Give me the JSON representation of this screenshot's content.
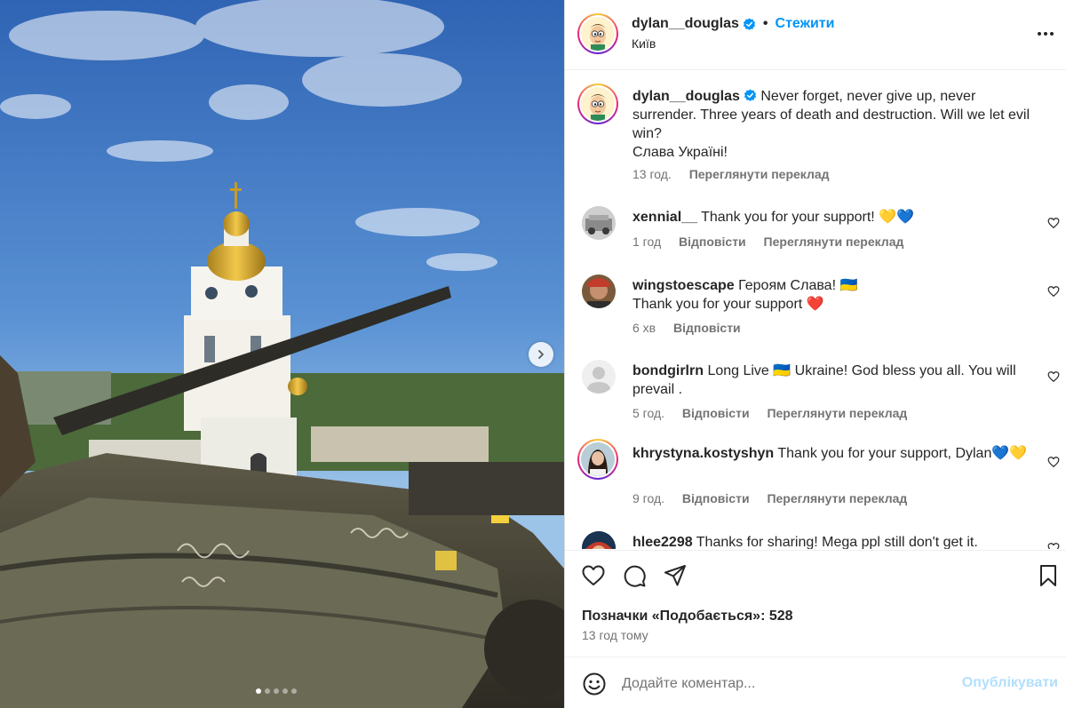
{
  "header": {
    "username": "dylan__douglas",
    "separator": "•",
    "follow_label": "Стежити",
    "location": "Київ",
    "more_icon": "more-horizontal-icon"
  },
  "media": {
    "next_icon": "chevron-right-icon",
    "slide_count": 5,
    "active_slide": 1
  },
  "caption": {
    "username": "dylan__douglas",
    "text_line1": "Never forget, never give up, never surrender. Three years of death and destruction. Will we let evil win?",
    "text_line2": "Слава Україні!",
    "time": "13 год.",
    "translate": "Переглянути переклад"
  },
  "comments": [
    {
      "username": "xennial__",
      "text": "Thank you for your support! 💛💙",
      "time": "1 год",
      "reply": "Відповісти",
      "translate": "Переглянути переклад"
    },
    {
      "username": "wingstoescape",
      "text": "Героям Слава! 🇺🇦",
      "text2": "Thank you for your support ❤️",
      "time": "6 хв",
      "reply": "Відповісти"
    },
    {
      "username": "bondgirlrn",
      "text": "Long Live 🇺🇦 Ukraine! God bless you all. You will prevail .",
      "time": "5 год.",
      "reply": "Відповісти",
      "translate": "Переглянути переклад"
    },
    {
      "username": "khrystyna.kostyshyn",
      "text": "Thank you for your support, Dylan💙💛",
      "time": "9 год.",
      "reply": "Відповісти",
      "translate": "Переглянути переклад"
    },
    {
      "username": "hlee2298",
      "text": "Thanks for sharing! Mega ppl still don't get it."
    }
  ],
  "actions": {
    "icons": [
      "heart-icon",
      "comment-icon",
      "share-icon",
      "bookmark-icon"
    ],
    "likes": "Позначки «Подобається»: 528",
    "time_ago": "13 год тому"
  },
  "composer": {
    "placeholder": "Додайте коментар...",
    "publish": "Опублікувати"
  },
  "colors": {
    "link": "#0095f6",
    "publish_disabled": "#b2dffc",
    "verified": "#0095f6",
    "muted": "#737373"
  }
}
